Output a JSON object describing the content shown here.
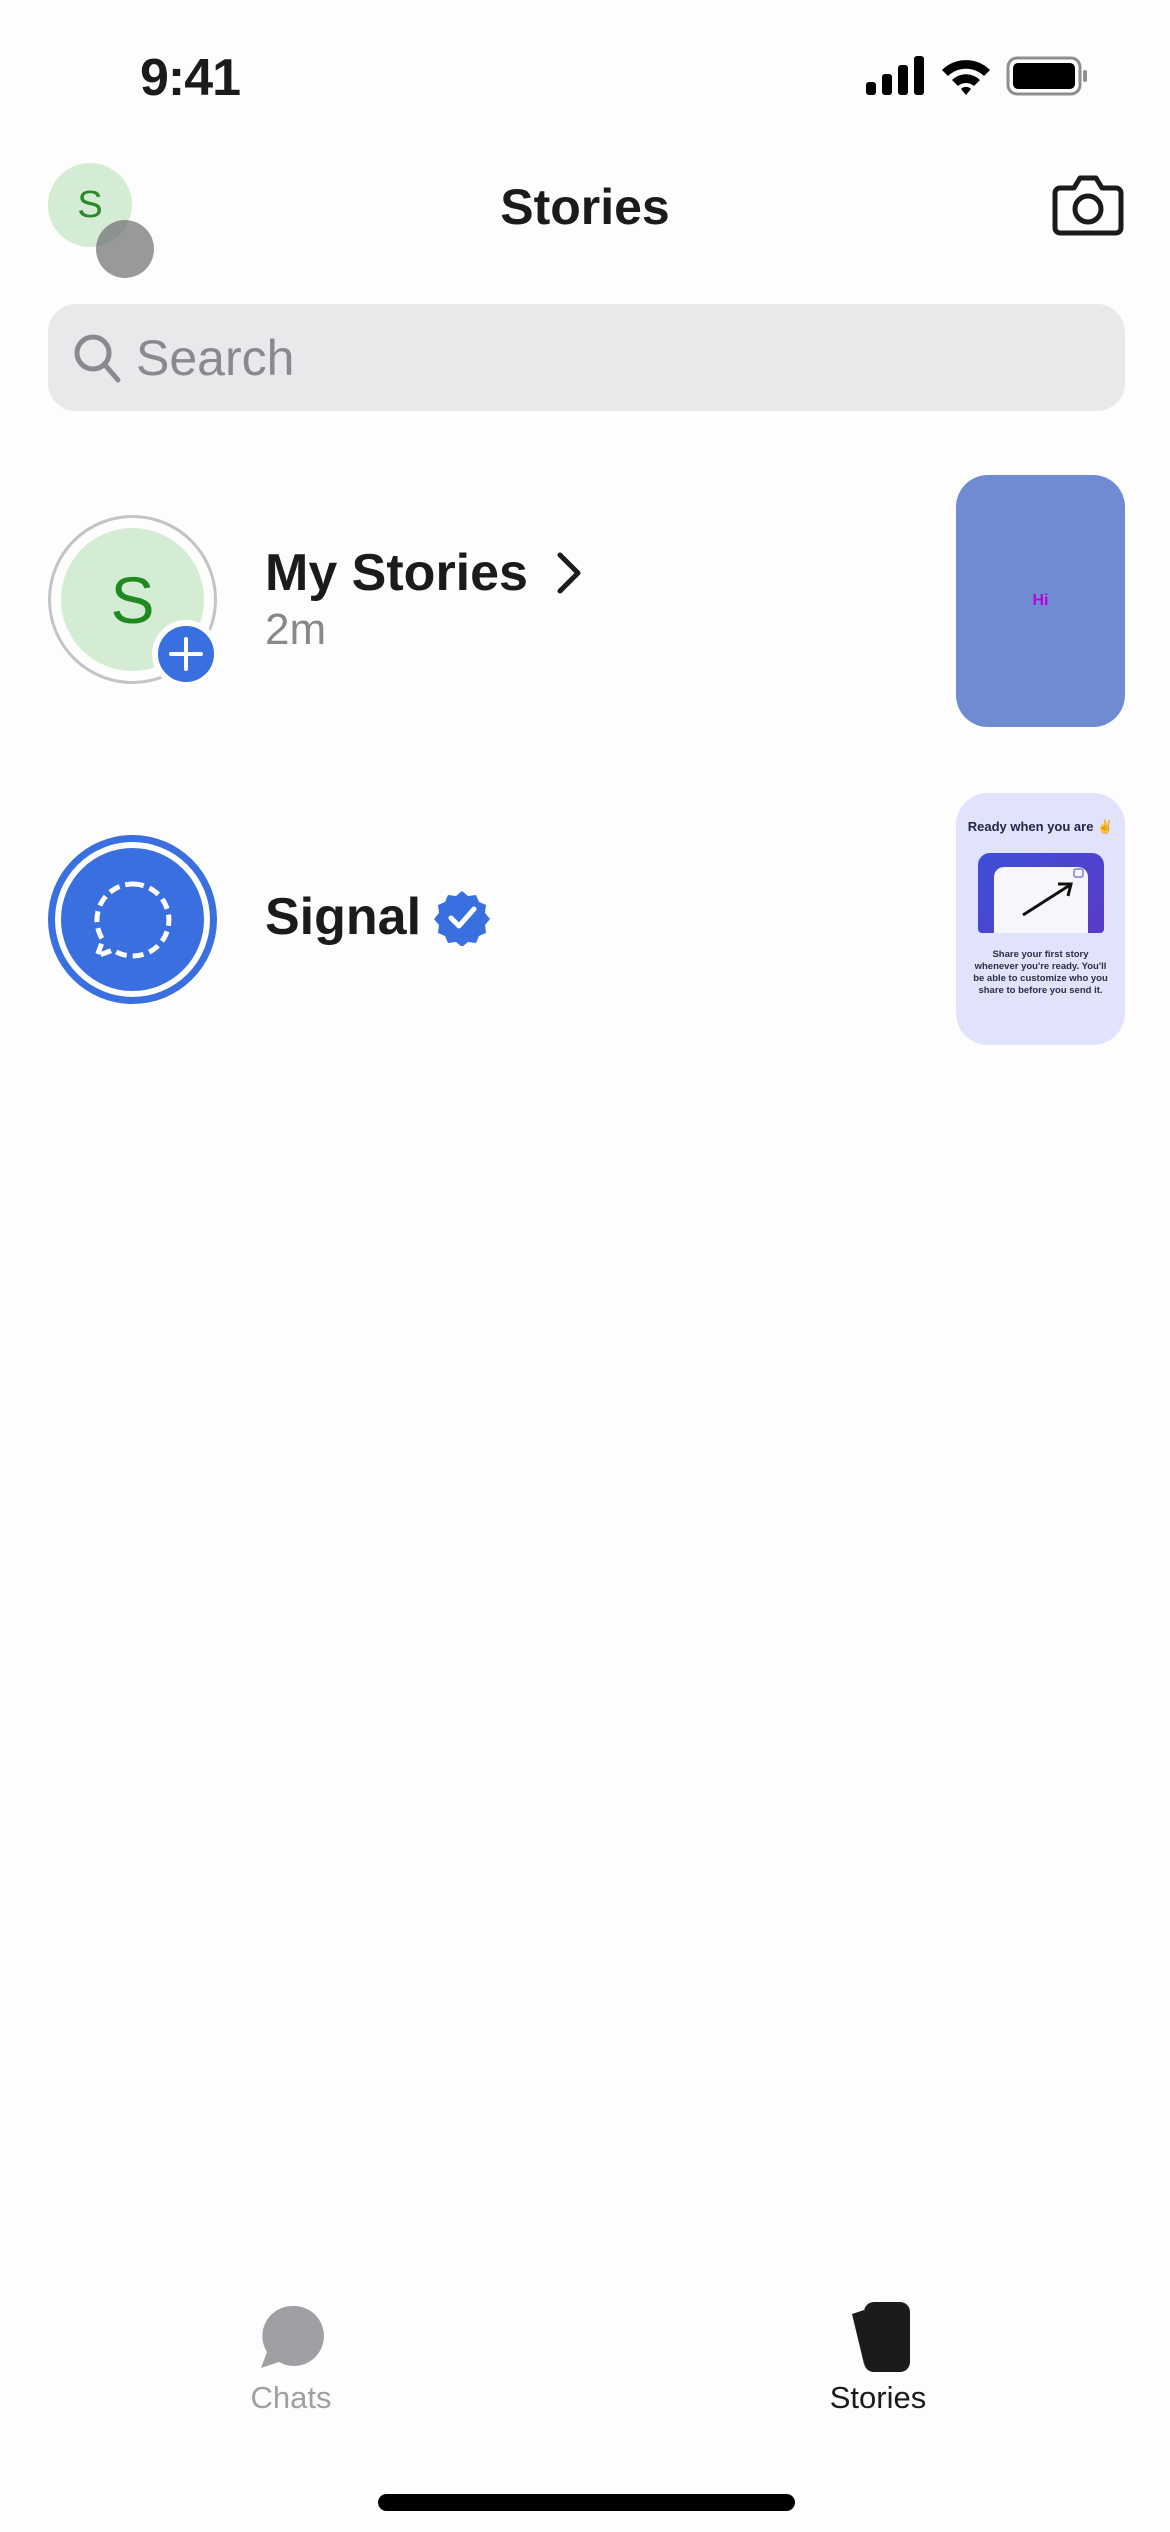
{
  "status_bar": {
    "time": "9:41",
    "icons": [
      "cellular-signal-icon",
      "wifi-icon",
      "battery-icon"
    ]
  },
  "header": {
    "avatar_initial": "S",
    "title": "Stories",
    "camera_icon": "camera-icon"
  },
  "search": {
    "placeholder": "Search",
    "value": ""
  },
  "stories": [
    {
      "title": "My Stories",
      "subtitle": "2m",
      "avatar_initial": "S",
      "thumbnail_text": "Hi",
      "has_chevron": true,
      "add_badge": true
    },
    {
      "title": "Signal",
      "verified": true,
      "thumbnail": {
        "title": "Ready when you are ✌️",
        "body": "Share your first story whenever you're ready. You'll be able to customize who you share to before you send it."
      }
    }
  ],
  "tab_bar": {
    "tabs": [
      {
        "label": "Chats",
        "icon": "chat-bubble-icon",
        "active": false
      },
      {
        "label": "Stories",
        "icon": "stories-icon",
        "active": true
      }
    ]
  },
  "colors": {
    "accent": "#3a6fe0",
    "avatar_bg": "#d3ecd3",
    "avatar_text": "#1f8a1f",
    "search_bg": "#e9e8eb",
    "muted": "#88878c"
  }
}
